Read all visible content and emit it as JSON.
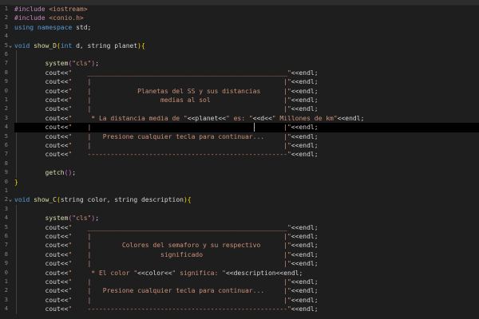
{
  "editor": {
    "line_numbers": [
      "1",
      "2",
      "3",
      "4",
      "5",
      "6",
      "7",
      "8",
      "9",
      "0",
      "1",
      "2",
      "3",
      "4",
      "5",
      "6",
      "7",
      "8",
      "9",
      "0",
      "1",
      "2",
      "3",
      "4",
      "5",
      "6",
      "7",
      "8",
      "9",
      "0",
      "1",
      "2",
      "3",
      "4"
    ],
    "lines": [
      [
        {
          "t": "#include ",
          "c": "pp"
        },
        {
          "t": "<iostream>",
          "c": "str"
        }
      ],
      [
        {
          "t": "#include ",
          "c": "pp"
        },
        {
          "t": "<conio.h>",
          "c": "str"
        }
      ],
      [
        {
          "t": "using ",
          "c": "kw"
        },
        {
          "t": "namespace ",
          "c": "kw"
        },
        {
          "t": "std",
          "c": "id"
        },
        {
          "t": ";",
          "c": "op"
        }
      ],
      [],
      [
        {
          "t": "void ",
          "c": "kw"
        },
        {
          "t": "show_D",
          "c": "fn"
        },
        {
          "t": "(",
          "c": "p1"
        },
        {
          "t": "int ",
          "c": "kw"
        },
        {
          "t": "d, ",
          "c": "id"
        },
        {
          "t": "string ",
          "c": "id"
        },
        {
          "t": "planet",
          "c": "id"
        },
        {
          "t": ")",
          "c": "p1"
        },
        {
          "t": "{",
          "c": "p1"
        }
      ],
      [],
      [
        {
          "t": "        system",
          "c": "fn"
        },
        {
          "t": "(",
          "c": "p2"
        },
        {
          "t": "\"cls\"",
          "c": "str"
        },
        {
          "t": ")",
          "c": "p2"
        },
        {
          "t": ";",
          "c": "op"
        }
      ],
      [
        {
          "t": "        cout",
          "c": "id"
        },
        {
          "t": "<<",
          "c": "op"
        },
        {
          "t": "\"    ____________________________________________________\"",
          "c": "str"
        },
        {
          "t": "<<",
          "c": "op"
        },
        {
          "t": "endl",
          "c": "id"
        },
        {
          "t": ";",
          "c": "op"
        }
      ],
      [
        {
          "t": "        cout",
          "c": "id"
        },
        {
          "t": "<<",
          "c": "op"
        },
        {
          "t": "\"    |                                                  |\"",
          "c": "str"
        },
        {
          "t": "<<",
          "c": "op"
        },
        {
          "t": "endl",
          "c": "id"
        },
        {
          "t": ";",
          "c": "op"
        }
      ],
      [
        {
          "t": "        cout",
          "c": "id"
        },
        {
          "t": "<<",
          "c": "op"
        },
        {
          "t": "\"    |            Planetas del SS y sus distancias      |\"",
          "c": "str"
        },
        {
          "t": "<<",
          "c": "op"
        },
        {
          "t": "endl",
          "c": "id"
        },
        {
          "t": ";",
          "c": "op"
        }
      ],
      [
        {
          "t": "        cout",
          "c": "id"
        },
        {
          "t": "<<",
          "c": "op"
        },
        {
          "t": "\"    |                  medias al sol                   |\"",
          "c": "str"
        },
        {
          "t": "<<",
          "c": "op"
        },
        {
          "t": "endl",
          "c": "id"
        },
        {
          "t": ";",
          "c": "op"
        }
      ],
      [
        {
          "t": "        cout",
          "c": "id"
        },
        {
          "t": "<<",
          "c": "op"
        },
        {
          "t": "\"    |                                                  |\"",
          "c": "str"
        },
        {
          "t": "<<",
          "c": "op"
        },
        {
          "t": "endl",
          "c": "id"
        },
        {
          "t": ";",
          "c": "op"
        }
      ],
      [
        {
          "t": "        cout",
          "c": "id"
        },
        {
          "t": "<<",
          "c": "op"
        },
        {
          "t": "\"     * La distancia media de \"",
          "c": "str"
        },
        {
          "t": "<<",
          "c": "op"
        },
        {
          "t": "planet",
          "c": "id"
        },
        {
          "t": "<<",
          "c": "op"
        },
        {
          "t": "\" es: \"",
          "c": "str"
        },
        {
          "t": "<<",
          "c": "op"
        },
        {
          "t": "d",
          "c": "id"
        },
        {
          "t": "<<",
          "c": "op"
        },
        {
          "t": "\" Millones de km\"",
          "c": "str"
        },
        {
          "t": "<<",
          "c": "op"
        },
        {
          "t": "endl",
          "c": "id"
        },
        {
          "t": ";",
          "c": "op"
        }
      ],
      [
        {
          "t": "        cout",
          "c": "id"
        },
        {
          "t": "<<",
          "c": "op"
        },
        {
          "t": "\"    |                                                  |\"",
          "c": "str"
        },
        {
          "t": "<<",
          "c": "op"
        },
        {
          "t": "endl",
          "c": "id"
        },
        {
          "t": ";",
          "c": "op"
        }
      ],
      [
        {
          "t": "        cout",
          "c": "id"
        },
        {
          "t": "<<",
          "c": "op"
        },
        {
          "t": "\"    |   Presione cualquier tecla para continuar...     |\"",
          "c": "str"
        },
        {
          "t": "<<",
          "c": "op"
        },
        {
          "t": "endl",
          "c": "id"
        },
        {
          "t": ";",
          "c": "op"
        }
      ],
      [
        {
          "t": "        cout",
          "c": "id"
        },
        {
          "t": "<<",
          "c": "op"
        },
        {
          "t": "\"    |                                                  |\"",
          "c": "str"
        },
        {
          "t": "<<",
          "c": "op"
        },
        {
          "t": "endl",
          "c": "id"
        },
        {
          "t": ";",
          "c": "op"
        }
      ],
      [
        {
          "t": "        cout",
          "c": "id"
        },
        {
          "t": "<<",
          "c": "op"
        },
        {
          "t": "\"    ----------------------------------------------------\"",
          "c": "str"
        },
        {
          "t": "<<",
          "c": "op"
        },
        {
          "t": "endl",
          "c": "id"
        },
        {
          "t": ";",
          "c": "op"
        }
      ],
      [],
      [
        {
          "t": "        getch",
          "c": "fn"
        },
        {
          "t": "(",
          "c": "p2"
        },
        {
          "t": ")",
          "c": "p2"
        },
        {
          "t": ";",
          "c": "op"
        }
      ],
      [
        {
          "t": "}",
          "c": "p1"
        }
      ],
      [],
      [
        {
          "t": "void ",
          "c": "kw"
        },
        {
          "t": "show_C",
          "c": "fn"
        },
        {
          "t": "(",
          "c": "p1"
        },
        {
          "t": "string ",
          "c": "id"
        },
        {
          "t": "color, ",
          "c": "id"
        },
        {
          "t": "string ",
          "c": "id"
        },
        {
          "t": "description",
          "c": "id"
        },
        {
          "t": ")",
          "c": "p1"
        },
        {
          "t": "{",
          "c": "p1"
        }
      ],
      [],
      [
        {
          "t": "        system",
          "c": "fn"
        },
        {
          "t": "(",
          "c": "p2"
        },
        {
          "t": "\"cls\"",
          "c": "str"
        },
        {
          "t": ")",
          "c": "p2"
        },
        {
          "t": ";",
          "c": "op"
        }
      ],
      [
        {
          "t": "        cout",
          "c": "id"
        },
        {
          "t": "<<",
          "c": "op"
        },
        {
          "t": "\"    ____________________________________________________\"",
          "c": "str"
        },
        {
          "t": "<<",
          "c": "op"
        },
        {
          "t": "endl",
          "c": "id"
        },
        {
          "t": ";",
          "c": "op"
        }
      ],
      [
        {
          "t": "        cout",
          "c": "id"
        },
        {
          "t": "<<",
          "c": "op"
        },
        {
          "t": "\"    |                                                  |\"",
          "c": "str"
        },
        {
          "t": "<<",
          "c": "op"
        },
        {
          "t": "endl",
          "c": "id"
        },
        {
          "t": ";",
          "c": "op"
        }
      ],
      [
        {
          "t": "        cout",
          "c": "id"
        },
        {
          "t": "<<",
          "c": "op"
        },
        {
          "t": "\"    |        Colores del semaforo y su respectivo      |\"",
          "c": "str"
        },
        {
          "t": "<<",
          "c": "op"
        },
        {
          "t": "endl",
          "c": "id"
        },
        {
          "t": ";",
          "c": "op"
        }
      ],
      [
        {
          "t": "        cout",
          "c": "id"
        },
        {
          "t": "<<",
          "c": "op"
        },
        {
          "t": "\"    |                  significado                     |\"",
          "c": "str"
        },
        {
          "t": "<<",
          "c": "op"
        },
        {
          "t": "endl",
          "c": "id"
        },
        {
          "t": ";",
          "c": "op"
        }
      ],
      [
        {
          "t": "        cout",
          "c": "id"
        },
        {
          "t": "<<",
          "c": "op"
        },
        {
          "t": "\"    |                                                  |\"",
          "c": "str"
        },
        {
          "t": "<<",
          "c": "op"
        },
        {
          "t": "endl",
          "c": "id"
        },
        {
          "t": ";",
          "c": "op"
        }
      ],
      [
        {
          "t": "        cout",
          "c": "id"
        },
        {
          "t": "<<",
          "c": "op"
        },
        {
          "t": "\"     * El color \"",
          "c": "str"
        },
        {
          "t": "<<",
          "c": "op"
        },
        {
          "t": "color",
          "c": "id"
        },
        {
          "t": "<<",
          "c": "op"
        },
        {
          "t": "\" significa: \"",
          "c": "str"
        },
        {
          "t": "<<",
          "c": "op"
        },
        {
          "t": "description",
          "c": "id"
        },
        {
          "t": "<<",
          "c": "op"
        },
        {
          "t": "endl",
          "c": "id"
        },
        {
          "t": ";",
          "c": "op"
        }
      ],
      [
        {
          "t": "        cout",
          "c": "id"
        },
        {
          "t": "<<",
          "c": "op"
        },
        {
          "t": "\"    |                                                  |\"",
          "c": "str"
        },
        {
          "t": "<<",
          "c": "op"
        },
        {
          "t": "endl",
          "c": "id"
        },
        {
          "t": ";",
          "c": "op"
        }
      ],
      [
        {
          "t": "        cout",
          "c": "id"
        },
        {
          "t": "<<",
          "c": "op"
        },
        {
          "t": "\"    |   Presione cualquier tecla para continuar...     |\"",
          "c": "str"
        },
        {
          "t": "<<",
          "c": "op"
        },
        {
          "t": "endl",
          "c": "id"
        },
        {
          "t": ";",
          "c": "op"
        }
      ],
      [
        {
          "t": "        cout",
          "c": "id"
        },
        {
          "t": "<<",
          "c": "op"
        },
        {
          "t": "\"    |                                                  |\"",
          "c": "str"
        },
        {
          "t": "<<",
          "c": "op"
        },
        {
          "t": "endl",
          "c": "id"
        },
        {
          "t": ";",
          "c": "op"
        }
      ],
      [
        {
          "t": "        cout",
          "c": "id"
        },
        {
          "t": "<<",
          "c": "op"
        },
        {
          "t": "\"    ----------------------------------------------------\"",
          "c": "str"
        },
        {
          "t": "<<",
          "c": "op"
        },
        {
          "t": "endl",
          "c": "id"
        },
        {
          "t": ";",
          "c": "op"
        }
      ]
    ],
    "current_line": 13,
    "fold_markers": [
      "collapse-icon",
      "collapse-icon"
    ]
  },
  "colors": {
    "background": "#1e1e1e",
    "preprocessor": "#c586c0",
    "string": "#ce9178",
    "keyword": "#569cd6",
    "function": "#dcdcaa",
    "bracket_level_1": "#ffd700",
    "bracket_level_2": "#da70d6",
    "line_number": "#858585",
    "current_line_highlight": "#000000"
  }
}
